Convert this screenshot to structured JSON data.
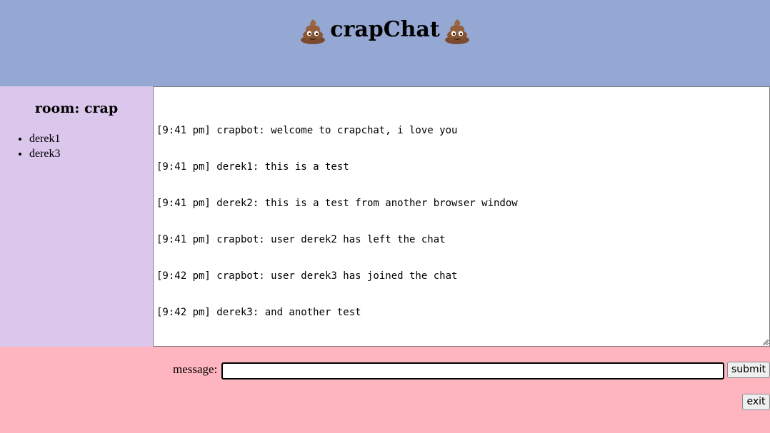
{
  "header": {
    "title": "crapChat",
    "left_icon": "poop-emoji-icon",
    "right_icon": "poop-emoji-icon"
  },
  "sidebar": {
    "room_title": "room: crap",
    "users": [
      "derek1",
      "derek3"
    ]
  },
  "chat": {
    "lines": [
      "[9:41 pm] crapbot: welcome to crapchat, i love you",
      "[9:41 pm] derek1: this is a test",
      "[9:41 pm] derek2: this is a test from another browser window",
      "[9:41 pm] crapbot: user derek2 has left the chat",
      "[9:42 pm] crapbot: user derek3 has joined the chat",
      "[9:42 pm] derek3: and another test"
    ]
  },
  "footer": {
    "message_label": "message:",
    "message_value": "",
    "submit_label": "submit",
    "exit_label": "exit"
  },
  "colors": {
    "header_bg": "#94a8d3",
    "sidebar_bg": "#dbc6ec",
    "footer_bg": "#ffb5c0"
  }
}
